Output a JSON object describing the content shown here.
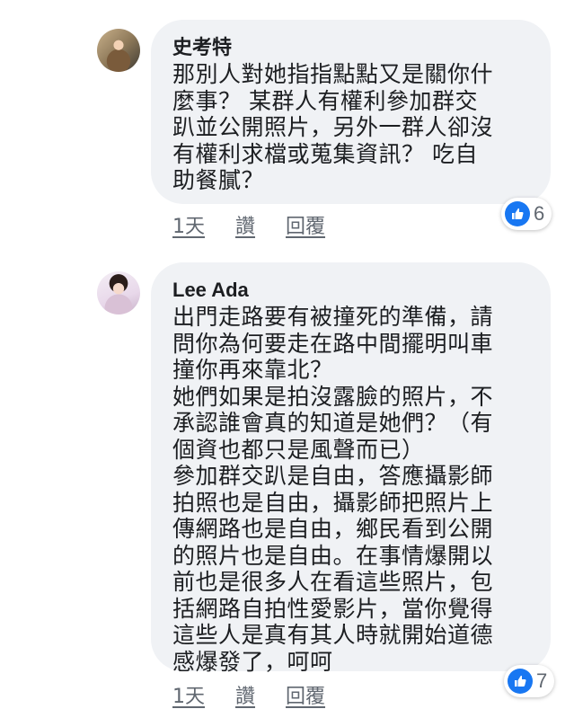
{
  "comments": [
    {
      "author": "史考特",
      "text": "那別人對她指指點點又是關你什\n麼事？ 某群人有權利參加群交\n趴並公開照片，另外一群人卻沒\n有權利求檔或蒐集資訊？ 吃自\n助餐膩？",
      "time": "1天",
      "like_label": "讚",
      "reply_label": "回覆",
      "reaction_count": "6"
    },
    {
      "author": "Lee Ada",
      "text": "出門走路要有被撞死的準備，請\n問你為何要走在路中間擺明叫車\n撞你再來靠北？\n她們如果是拍沒露臉的照片，不\n承認誰會真的知道是她們？（有\n個資也都只是風聲而已）\n參加群交趴是自由，答應攝影師\n拍照也是自由，攝影師把照片上\n傳網路也是自由，鄉民看到公開\n的照片也是自由。在事情爆開以\n前也是很多人在看這些照片，包\n括網路自拍性愛影片，當你覺得\n這些人是真有其人時就開始道德\n感爆發了，呵呵",
      "time": "1天",
      "like_label": "讚",
      "reply_label": "回覆",
      "reaction_count": "7"
    }
  ],
  "colors": {
    "bubble": "#f0f2f5",
    "like_blue": "#1877f2",
    "meta_text": "#606770"
  }
}
